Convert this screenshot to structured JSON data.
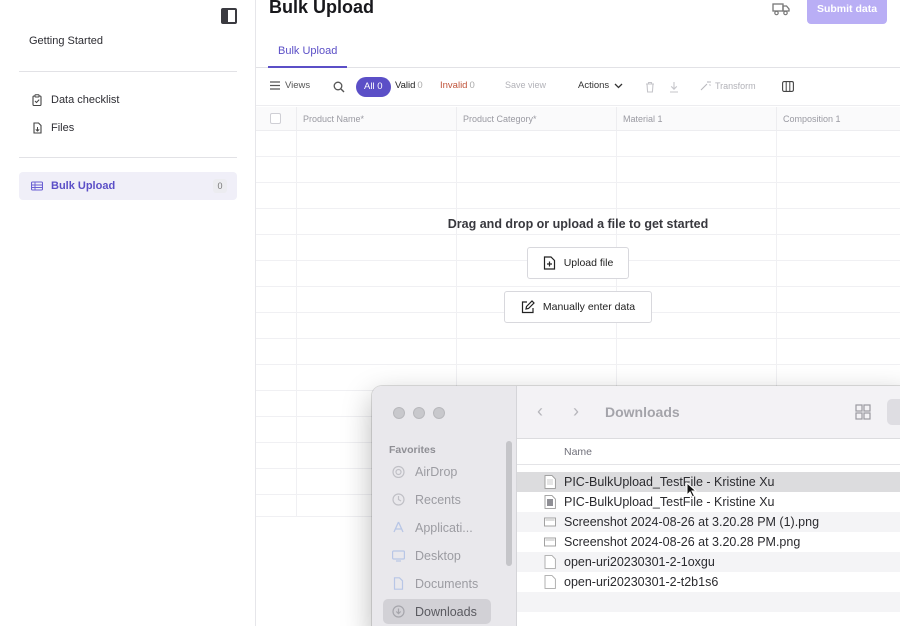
{
  "sidebar": {
    "heading": "Getting Started",
    "items": [
      {
        "label": "Data checklist",
        "icon": "clipboard-icon"
      },
      {
        "label": "Files",
        "icon": "file-icon"
      }
    ],
    "active_item": {
      "label": "Bulk Upload",
      "icon": "table-icon",
      "badge": "0"
    }
  },
  "header": {
    "title": "Bulk Upload",
    "submit_label": "Submit data"
  },
  "tabs": [
    {
      "label": "Bulk Upload"
    }
  ],
  "toolbar": {
    "views": "Views",
    "all_label": "All",
    "all_count": "0",
    "valid_label": "Valid",
    "valid_count": "0",
    "invalid_label": "Invalid",
    "invalid_count": "0",
    "save_view": "Save view",
    "actions": "Actions",
    "transform": "Transform"
  },
  "grid": {
    "columns": [
      "Product Name*",
      "Product Category*",
      "Material 1",
      "Composition 1"
    ]
  },
  "empty_state": {
    "message": "Drag and drop or upload a file to get started",
    "upload_label": "Upload file",
    "manual_label": "Manually enter data"
  },
  "finder": {
    "location": "Downloads",
    "favorites_label": "Favorites",
    "sidebar_items": [
      {
        "label": "AirDrop",
        "icon": "airdrop-icon"
      },
      {
        "label": "Recents",
        "icon": "clock-icon"
      },
      {
        "label": "Applicati...",
        "icon": "applications-icon"
      },
      {
        "label": "Desktop",
        "icon": "desktop-icon"
      },
      {
        "label": "Documents",
        "icon": "document-icon"
      },
      {
        "label": "Downloads",
        "icon": "download-icon"
      }
    ],
    "column_name": "Name",
    "files": [
      "PIC-BulkUpload_TestFile - Kristine Xu",
      "PIC-BulkUpload_TestFile - Kristine Xu",
      "Screenshot 2024-08-26 at 3.20.28 PM (1).png",
      "Screenshot 2024-08-26 at 3.20.28 PM.png",
      "open-uri20230301-2-1oxgu",
      "open-uri20230301-2-t2b1s6"
    ]
  }
}
